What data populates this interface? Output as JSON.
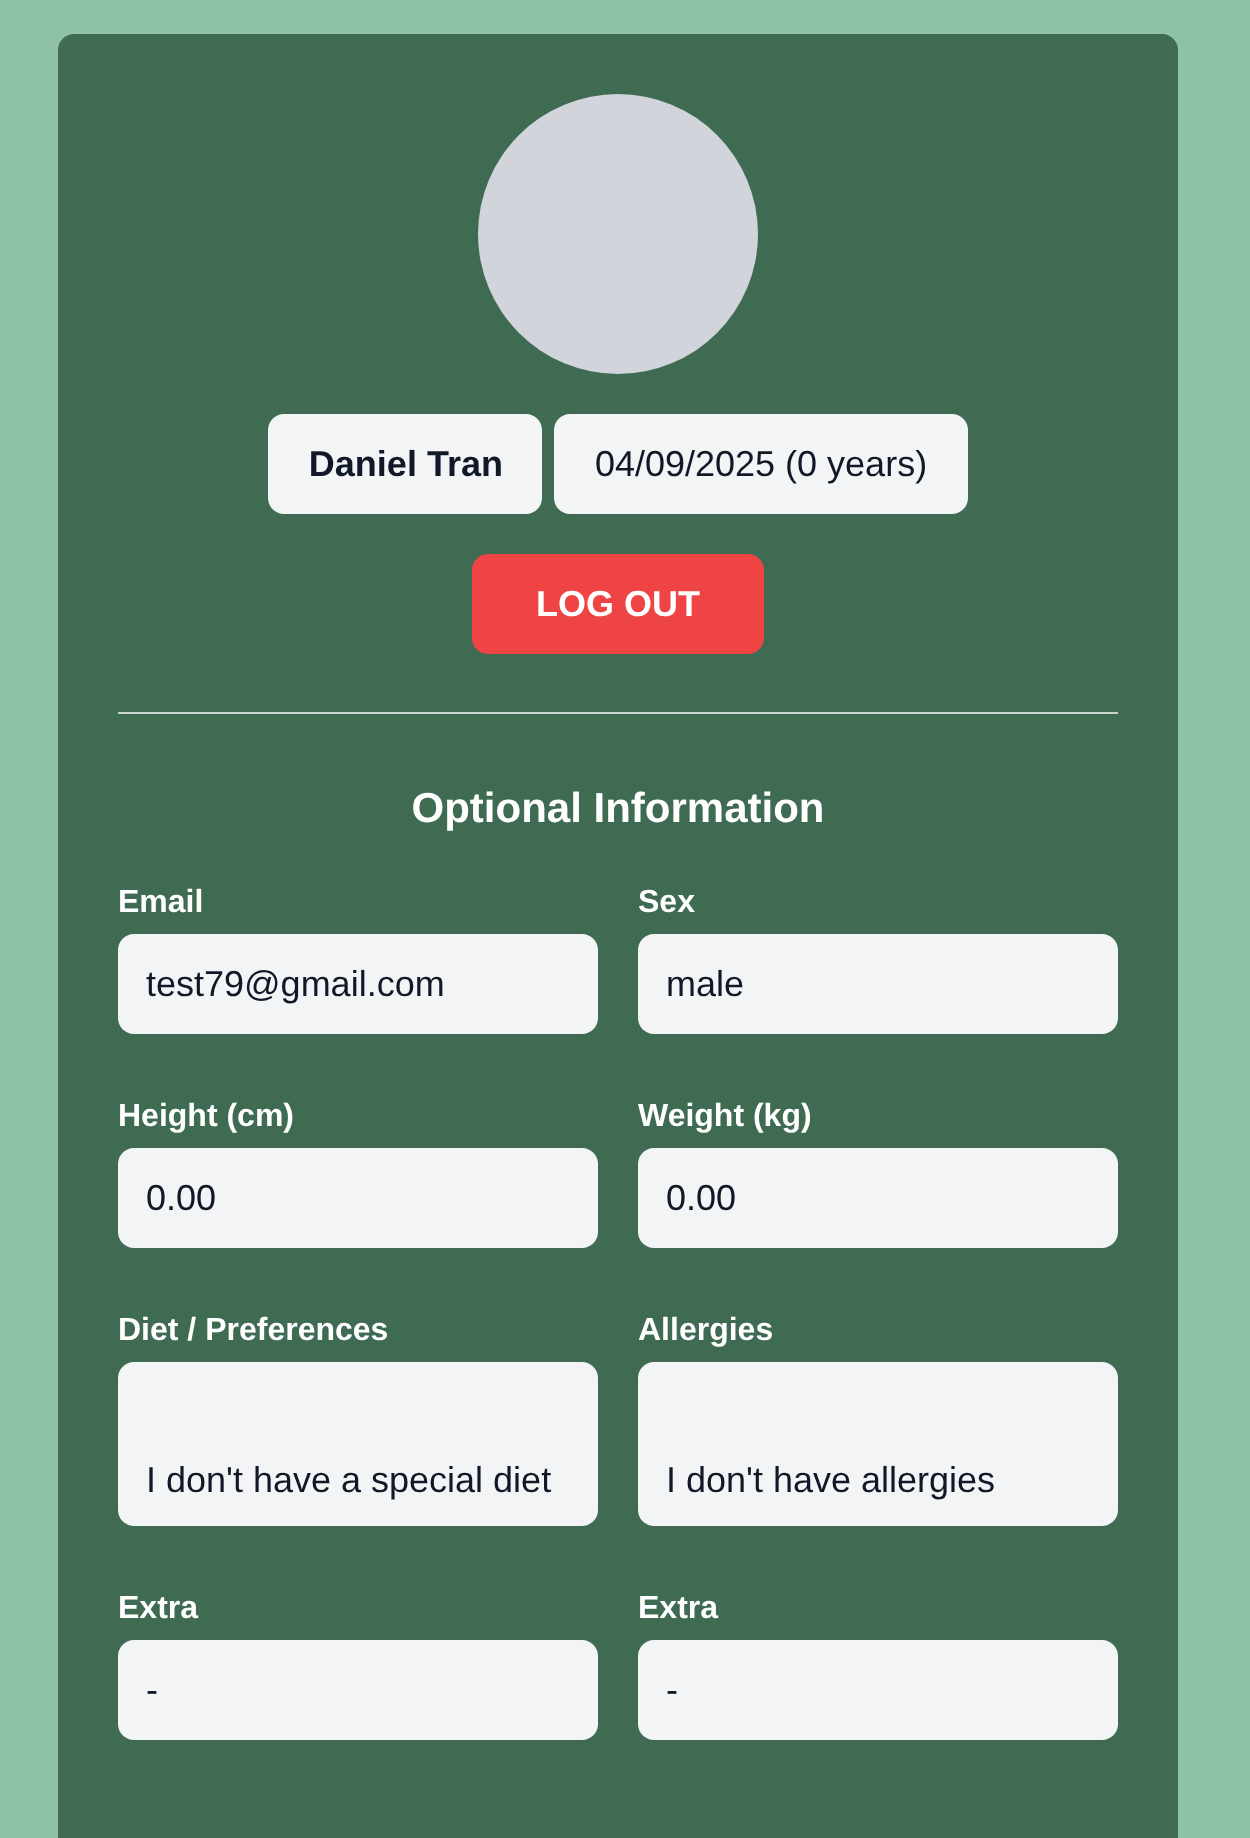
{
  "profile": {
    "name": "Daniel Tran",
    "birth": "04/09/2025 (0 years)"
  },
  "logout": "LOG OUT",
  "section_title": "Optional Information",
  "fields": [
    {
      "label": "Email",
      "value": "test79@gmail.com",
      "kind": "input"
    },
    {
      "label": "Sex",
      "value": "male",
      "kind": "input"
    },
    {
      "label": "Height (cm)",
      "value": "0.00",
      "kind": "input"
    },
    {
      "label": "Weight (kg)",
      "value": "0.00",
      "kind": "input"
    },
    {
      "label": "Diet / Preferences",
      "value": "I don't have a special diet",
      "kind": "textarea"
    },
    {
      "label": "Allergies",
      "value": "I don't have allergies",
      "kind": "textarea"
    },
    {
      "label": "Extra",
      "value": "-",
      "kind": "input"
    },
    {
      "label": "Extra",
      "value": "-",
      "kind": "input"
    }
  ]
}
